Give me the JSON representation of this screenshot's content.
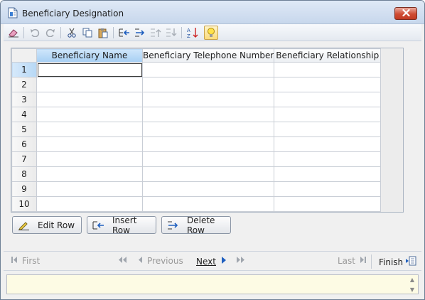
{
  "window": {
    "title": "Beneficiary Designation"
  },
  "toolbar": {
    "icons": [
      "eraser-icon",
      "undo-icon",
      "redo-icon",
      "cut-icon",
      "copy-icon",
      "paste-icon",
      "outdent-icon",
      "indent-icon",
      "move-up-icon",
      "move-down-icon",
      "sort-az-icon",
      "lightbulb-icon"
    ]
  },
  "grid": {
    "columns": [
      "Beneficiary Name",
      "Beneficiary Telephone Number",
      "Beneficiary Relationship"
    ],
    "rows": [
      {
        "num": "1"
      },
      {
        "num": "2"
      },
      {
        "num": "3"
      },
      {
        "num": "4"
      },
      {
        "num": "5"
      },
      {
        "num": "6"
      },
      {
        "num": "7"
      },
      {
        "num": "8"
      },
      {
        "num": "9"
      },
      {
        "num": "10"
      }
    ]
  },
  "actions": {
    "edit_row": "Edit Row",
    "insert_row": "Insert Row",
    "delete_row": "Delete Row"
  },
  "nav": {
    "first": "First",
    "previous": "Previous",
    "next": "Next",
    "last": "Last",
    "finish": "Finish"
  },
  "colors": {
    "selected_header": "#a7cff3",
    "nav_arrow": "#1f5fbf",
    "info_background": "#fdfbe4",
    "close_button": "#cf4c33"
  }
}
